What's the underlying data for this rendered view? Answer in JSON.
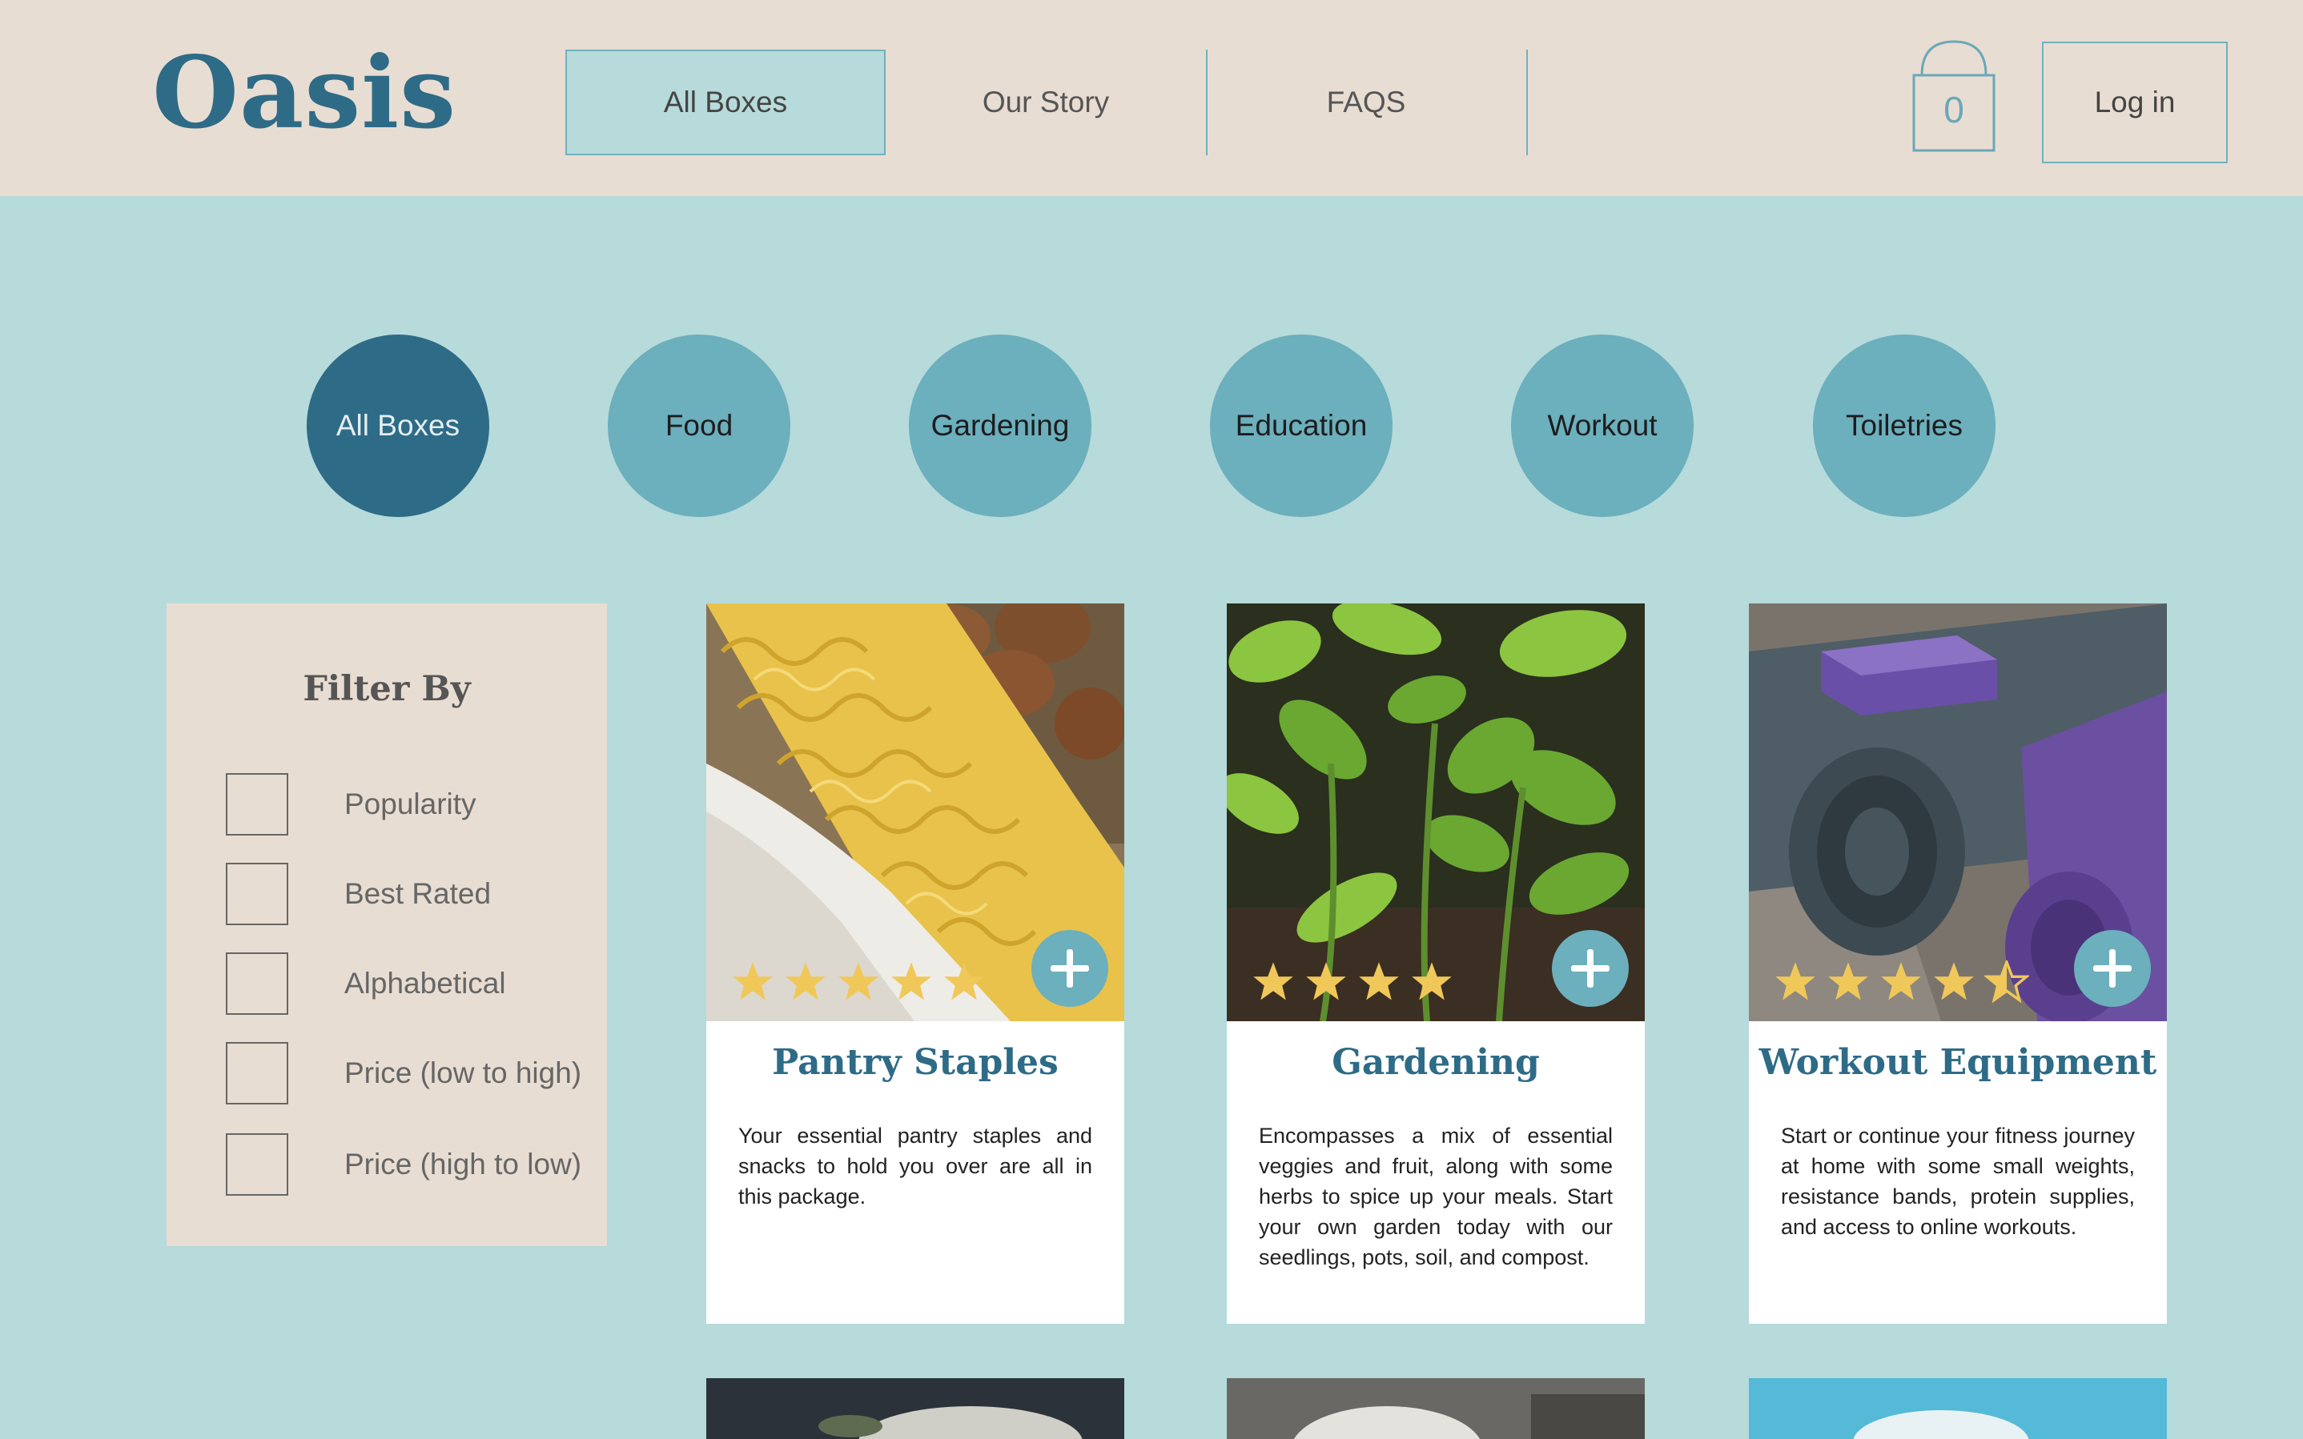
{
  "header": {
    "logo": "Oasis",
    "nav": [
      {
        "label": "All Boxes",
        "active": true
      },
      {
        "label": "Our Story",
        "active": false
      },
      {
        "label": "FAQS",
        "active": false
      }
    ],
    "cart_count": "0",
    "login_label": "Log in"
  },
  "categories": [
    {
      "label": "All Boxes",
      "active": true
    },
    {
      "label": "Food",
      "active": false
    },
    {
      "label": "Gardening",
      "active": false
    },
    {
      "label": "Education",
      "active": false
    },
    {
      "label": "Workout",
      "active": false
    },
    {
      "label": "Toiletries",
      "active": false
    }
  ],
  "filter": {
    "title": "Filter By",
    "options": [
      "Popularity",
      "Best Rated",
      "Alphabetical",
      "Price (low to high)",
      "Price (high to low)"
    ]
  },
  "products": [
    {
      "title": "Pantry Staples",
      "description": "Your essential pantry staples and snacks to hold you over are all in this package.",
      "rating": 5
    },
    {
      "title": "Gardening",
      "description": "Encompasses a mix of essential veggies and fruit, along with some herbs to spice up your meals. Start your own garden today with our seedlings, pots, soil, and compost.",
      "rating": 4
    },
    {
      "title": "Workout Equipment",
      "description": "Start or continue your fitness journey at home with some small weights, resistance bands, protein supplies, and access to online workouts.",
      "rating": 4.5
    }
  ],
  "colors": {
    "header_bg": "#e8ddd2",
    "page_bg": "#b7dadb",
    "accent": "#2e6b87",
    "category_bg": "#6cafbd",
    "star": "#f0c85a"
  }
}
